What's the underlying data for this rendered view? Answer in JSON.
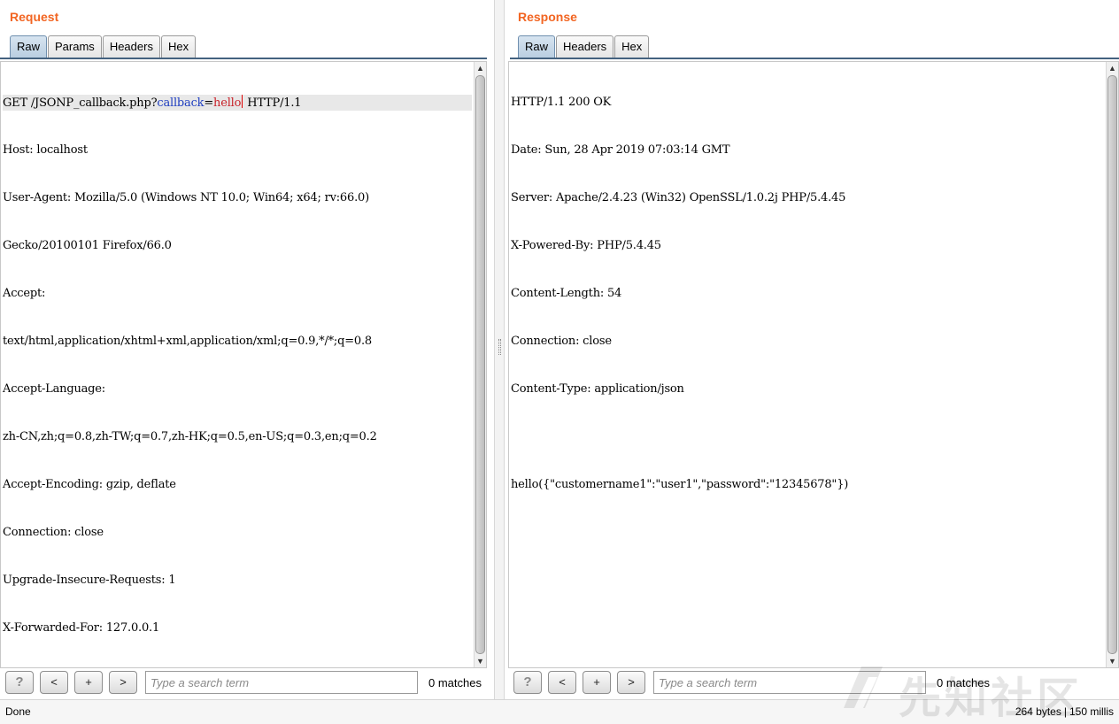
{
  "request": {
    "title": "Request",
    "tabs": [
      "Raw",
      "Params",
      "Headers",
      "Hex"
    ],
    "active_tab": "Raw",
    "first_line": {
      "prefix": "GET /JSONP_callback.php?",
      "param_name": "callback",
      "equals": "=",
      "param_value": "hello",
      "suffix": " HTTP/1.1"
    },
    "lines": [
      "Host: localhost",
      "User-Agent: Mozilla/5.0 (Windows NT 10.0; Win64; x64; rv:66.0)",
      "Gecko/20100101 Firefox/66.0",
      "Accept:",
      "text/html,application/xhtml+xml,application/xml;q=0.9,*/*;q=0.8",
      "Accept-Language:",
      "zh-CN,zh;q=0.8,zh-TW;q=0.7,zh-HK;q=0.5,en-US;q=0.3,en;q=0.2",
      "Accept-Encoding: gzip, deflate",
      "Connection: close",
      "Upgrade-Insecure-Requests: 1",
      "X-Forwarded-For: 127.0.0.1"
    ],
    "search": {
      "help_label": "?",
      "prev_label": "<",
      "add_label": "+",
      "next_label": ">",
      "placeholder": "Type a search term",
      "matches": "0 matches"
    }
  },
  "response": {
    "title": "Response",
    "tabs": [
      "Raw",
      "Headers",
      "Hex"
    ],
    "active_tab": "Raw",
    "lines": [
      "HTTP/1.1 200 OK",
      "Date: Sun, 28 Apr 2019 07:03:14 GMT",
      "Server: Apache/2.4.23 (Win32) OpenSSL/1.0.2j PHP/5.4.45",
      "X-Powered-By: PHP/5.4.45",
      "Content-Length: 54",
      "Connection: close",
      "Content-Type: application/json",
      "",
      "hello({\"customername1\":\"user1\",\"password\":\"12345678\"})"
    ],
    "search": {
      "help_label": "?",
      "prev_label": "<",
      "add_label": "+",
      "next_label": ">",
      "placeholder": "Type a search term",
      "matches": "0 matches"
    }
  },
  "status": {
    "left": "Done",
    "bytes": "264 bytes",
    "separator": "|",
    "time": "150 millis"
  },
  "watermark": {
    "text": "先知社区"
  },
  "colors": {
    "title_orange": "#f26522",
    "param_name": "#1f3ec0",
    "param_value": "#c8222a",
    "active_tab": "#b8cde0"
  }
}
